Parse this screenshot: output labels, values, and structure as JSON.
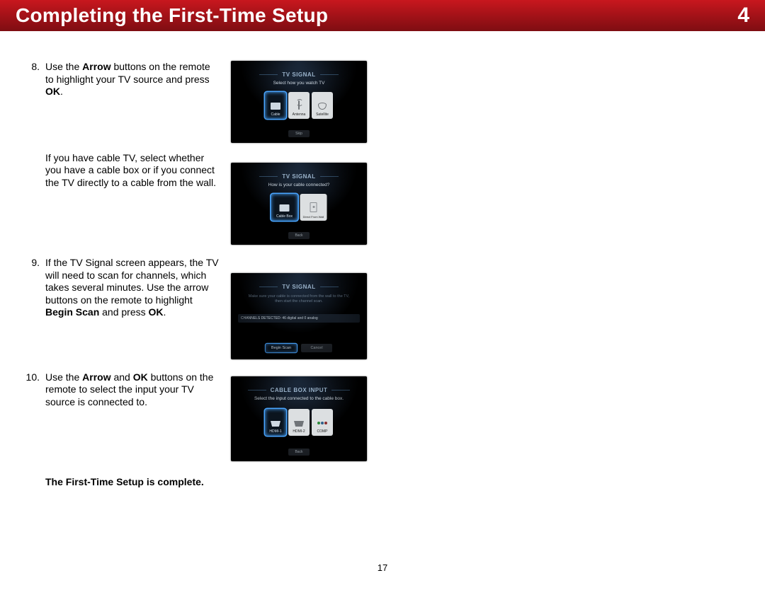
{
  "header": {
    "title": "Completing the First-Time Setup",
    "chapter": "4"
  },
  "page_number": "17",
  "completion": "The First-Time Setup is complete.",
  "steps": {
    "s8": {
      "num": "8.",
      "p1_a": "Use the ",
      "p1_b": "Arrow",
      "p1_c": " buttons on the remote to highlight your TV source and press ",
      "p1_d": "OK",
      "p1_e": ".",
      "p2": "If you have cable TV, select whether you have a cable box or if you connect the TV directly to a cable from the wall."
    },
    "s9": {
      "num": "9.",
      "p_a": "If the TV Signal screen appears, the TV will need to scan for channels, which takes several minutes. Use the arrow buttons on the remote to highlight ",
      "p_b": "Begin Scan",
      "p_c": " and press ",
      "p_d": "OK",
      "p_e": "."
    },
    "s10": {
      "num": "10.",
      "p_a": "Use the ",
      "p_b": "Arrow",
      "p_c": " and ",
      "p_d": "OK",
      "p_e": " buttons on the remote to select the input your TV source is connected to."
    }
  },
  "shots": {
    "s1": {
      "title": "TV SIGNAL",
      "sub": "Select how you watch TV",
      "opts": {
        "a": "Cable",
        "b": "Antenna",
        "c": "Satellite"
      },
      "back": "Skip"
    },
    "s2": {
      "title": "TV SIGNAL",
      "sub": "How is your cable connected?",
      "opts": {
        "a": "Cable Box",
        "b": "Direct From Wall"
      },
      "back": "Back"
    },
    "s3": {
      "title": "TV SIGNAL",
      "sub": "Make sure your cable is connected from the wall to the TV,\nthen start the channel scan.",
      "bar_left": "CHANNELS DETECTED: 46 digital and 0 analog",
      "buttons": {
        "begin": "Begin Scan",
        "cancel": "Cancel"
      }
    },
    "s4": {
      "title": "CABLE BOX INPUT",
      "sub": "Select the input connected to the cable box.",
      "opts": {
        "a": "HDMI-1",
        "b": "HDMI-2",
        "c": "COMP"
      },
      "back": "Back"
    }
  }
}
